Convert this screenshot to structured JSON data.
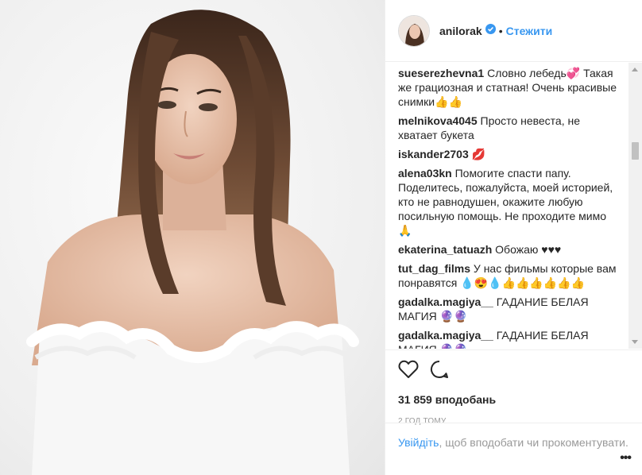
{
  "header": {
    "username": "anilorak",
    "separator": "•",
    "follow_label": "Стежити"
  },
  "comments": [
    {
      "user": "sueserezhevna1",
      "text": "Словно лебедь💞 Такая же грациозная и статная! Очень красивые снимки👍👍"
    },
    {
      "user": "melnikova4045",
      "text": "Просто невеста, не хватает букета"
    },
    {
      "user": "iskander2703",
      "text": "💋"
    },
    {
      "user": "alena03kn",
      "text": "Помогите спасти папу. Поделитесь, пожалуйста, моей историей, кто не равнодушен, окажите любую посильную помощь. Не проходите мимо 🙏"
    },
    {
      "user": "ekaterina_tatuazh",
      "text": "Обожаю ♥♥♥"
    },
    {
      "user": "tut_dag_films",
      "text": "У нас фильмы которые вам понравятся 💧😍💧👍👍👍👍👍👍"
    },
    {
      "user": "gadalka.magiya__",
      "text": "ГАДАНИЕ БЕЛАЯ МАГИЯ 🔮🔮"
    },
    {
      "user": "gadalka.magiya__",
      "text": "ГАДАНИЕ БЕЛАЯ МАГИЯ 🔮🔮"
    }
  ],
  "actions": {
    "like_icon": "heart-icon",
    "comment_icon": "comment-icon"
  },
  "likes": "31 859 вподобань",
  "timestamp": "2 год тому",
  "footer": {
    "login_link": "Увійдіть",
    "rest_text": ", щоб вподобати чи прокоментувати.",
    "more_label": "•••"
  },
  "colors": {
    "link_blue": "#3897f0",
    "verified_blue": "#3897f0",
    "muted": "#999999"
  }
}
